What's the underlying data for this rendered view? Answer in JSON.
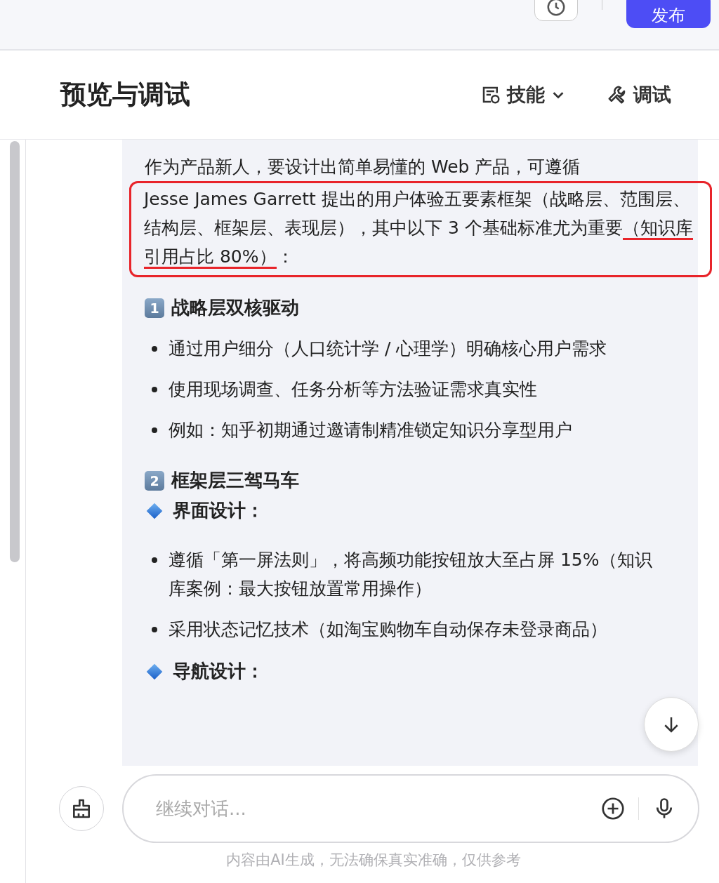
{
  "top_bar": {
    "publish_button": "发布"
  },
  "header": {
    "title": "预览与调试",
    "skills_button": "技能",
    "debug_button": "调试"
  },
  "message": {
    "intro": "作为产品新人，要设计出简单易懂的 Web 产品，可遵循",
    "highlight": {
      "before": "Jesse James Garrett 提出的用户体验五要素框架（战略层、范围层、结构层、框架层、表现层），其中以下 3 个基础标准尤为重要",
      "underlined": "（知识库引用占比 80%）",
      "after": "："
    },
    "sections": [
      {
        "badge": "1",
        "title": "战略层双核驱动",
        "blocks": [
          {
            "kind": "bullets",
            "items": [
              "通过用户细分（人口统计学 / 心理学）明确核心用户需求",
              "使用现场调查、任务分析等方法验证需求真实性",
              "例如：知乎初期通过邀请制精准锁定知识分享型用户"
            ]
          }
        ]
      },
      {
        "badge": "2",
        "title": "框架层三驾马车",
        "blocks": [
          {
            "kind": "subheading",
            "text": "界面设计："
          },
          {
            "kind": "bullets",
            "items": [
              "遵循「第一屏法则」，将高频功能按钮放大至占屏 15%（知识库案例：最大按钮放置常用操作）",
              "采用状态记忆技术（如淘宝购物车自动保存未登录商品）"
            ]
          },
          {
            "kind": "subheading",
            "text": "导航设计："
          }
        ]
      }
    ]
  },
  "input": {
    "placeholder": "继续对话..."
  },
  "disclaimer": "内容由AI生成，无法确保真实准确，仅供参考"
}
